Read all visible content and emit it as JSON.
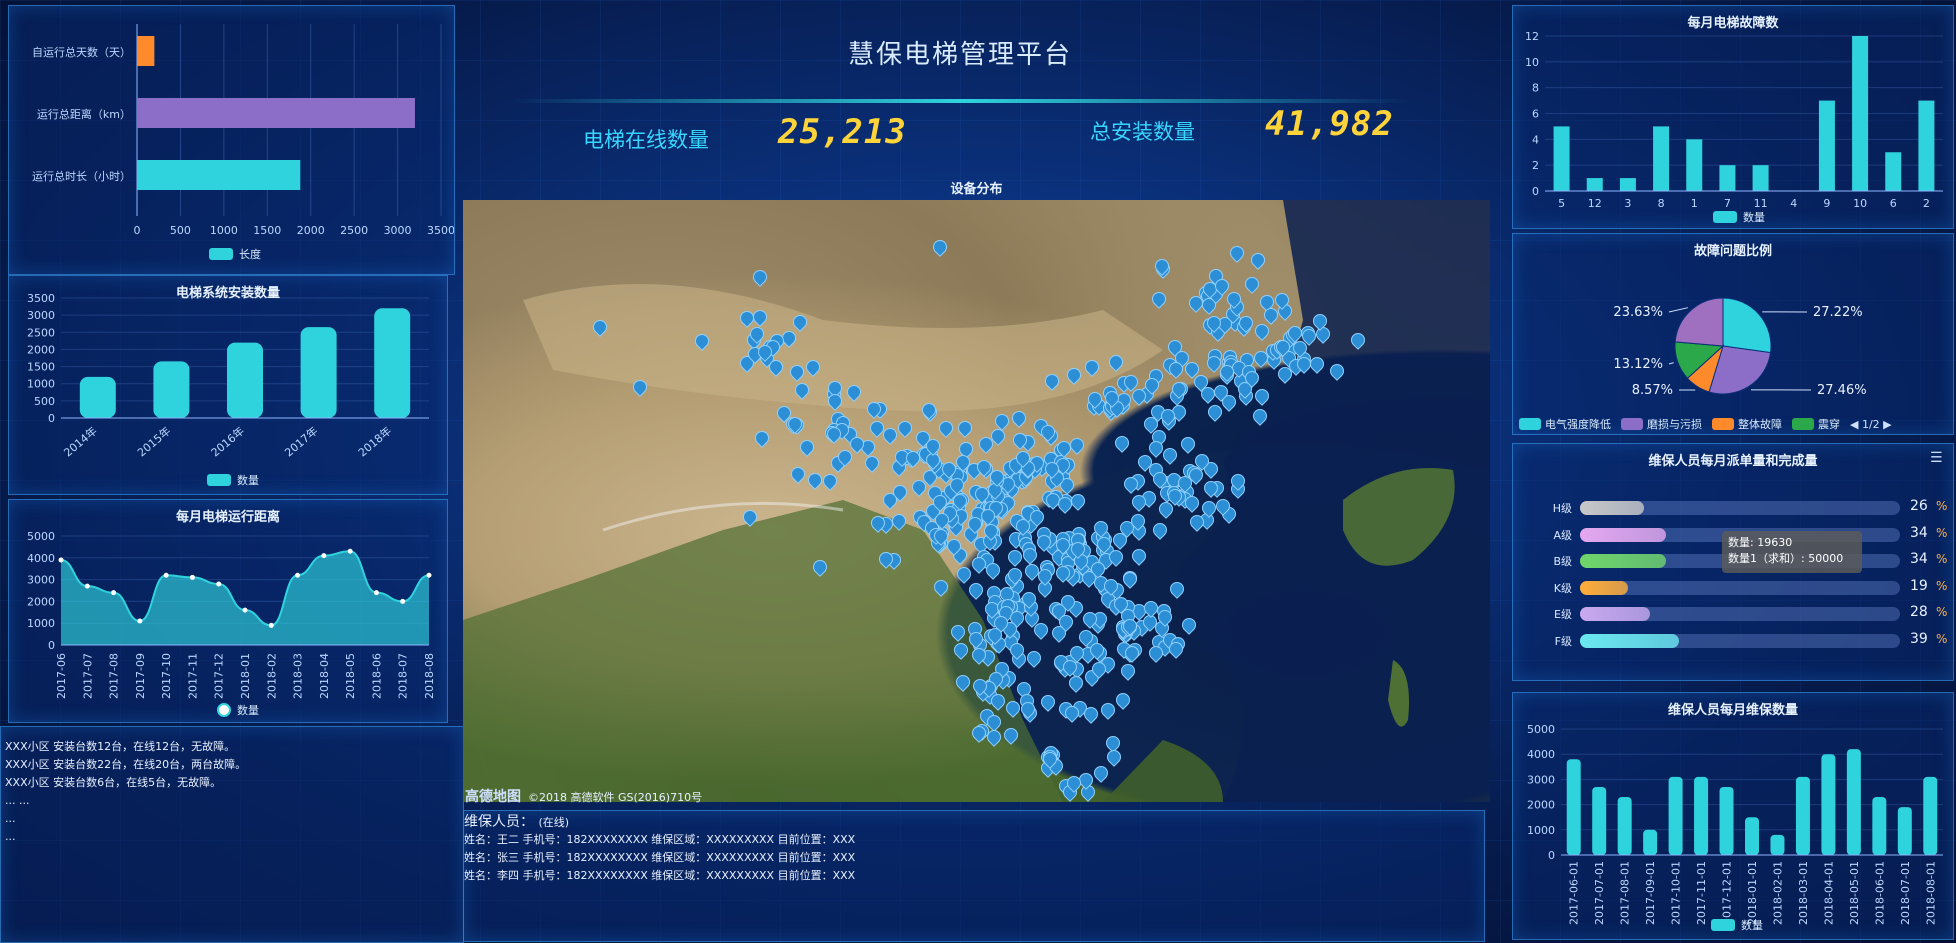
{
  "header": {
    "title": "慧保电梯管理平台",
    "online_label": "电梯在线数量",
    "online_value": "25,213",
    "installed_label": "总安装数量",
    "installed_value": "41,982"
  },
  "top_left": {
    "categories": [
      "自运行总天数（天）",
      "运行总距离（km）",
      "运行总时长（小时）"
    ],
    "values": [
      200,
      3200,
      1880
    ],
    "colors": [
      "#ff8a2b",
      "#8c6ec8",
      "#2fd3dd"
    ],
    "ticks": [
      "0",
      "500",
      "1000",
      "1500",
      "2000",
      "2500",
      "3000",
      "3500"
    ],
    "legend": "长度"
  },
  "install_chart": {
    "title": "电梯系统安装数量",
    "categories": [
      "2014年",
      "2015年",
      "2016年",
      "2017年",
      "2018年"
    ],
    "values": [
      1200,
      1650,
      2200,
      2650,
      3200
    ],
    "yticks": [
      "0",
      "500",
      "1000",
      "1500",
      "2000",
      "2500",
      "3000",
      "3500"
    ],
    "legend": "数量"
  },
  "distance_chart": {
    "title": "每月电梯运行距离",
    "categories": [
      "2017-06",
      "2017-07",
      "2017-08",
      "2017-09",
      "2017-10",
      "2017-11",
      "2017-12",
      "2018-01",
      "2018-02",
      "2018-03",
      "2018-04",
      "2018-05",
      "2018-06",
      "2018-07",
      "2018-08"
    ],
    "values": [
      3900,
      2700,
      2400,
      1100,
      3200,
      3100,
      2800,
      1600,
      900,
      3200,
      4100,
      4300,
      2400,
      2000,
      3200
    ],
    "yticks": [
      "0",
      "1000",
      "2000",
      "3000",
      "4000",
      "5000"
    ],
    "legend": "数量"
  },
  "notices": [
    "XXX小区 安装台数12台，在线12台，无故障。",
    "XXX小区 安装台数22台，在线20台，两台故障。",
    "XXX小区 安装台数6台，在线5台，无故障。",
    "... ...",
    "...",
    "..."
  ],
  "map": {
    "title": "设备分布",
    "credit_logo": "高德地图",
    "credit_text": "©2018 高德软件 GS(2016)710号"
  },
  "staff": {
    "heading": "维保人员：",
    "status": "(在线)",
    "rows": [
      "姓名：王二    手机号：182XXXXXXXX  维保区域：XXXXXXXXX  目前位置：XXX",
      "姓名：张三    手机号：182XXXXXXXX  维保区域：XXXXXXXXX  目前位置：XXX",
      "姓名：李四    手机号：182XXXXXXXX  维保区域：XXXXXXXXX  目前位置：XXX"
    ]
  },
  "fault_monthly": {
    "title": "每月电梯故障数",
    "categories": [
      "5",
      "12",
      "3",
      "8",
      "1",
      "7",
      "11",
      "4",
      "9",
      "10",
      "6",
      "2"
    ],
    "values": [
      5,
      1,
      1,
      5,
      4,
      2,
      2,
      0,
      7,
      12,
      3,
      7
    ],
    "yticks": [
      "0",
      "2",
      "4",
      "6",
      "8",
      "10",
      "12"
    ],
    "legend": "数量"
  },
  "fault_ratio": {
    "title": "故障问题比例",
    "slices": [
      {
        "name": "电气强度降低",
        "value": 27.22,
        "color": "#2fd3dd"
      },
      {
        "name": "磨损与污损",
        "value": 27.46,
        "color": "#8c6ec8"
      },
      {
        "name": "整体故障",
        "value": 8.57,
        "color": "#ff8a2b"
      },
      {
        "name": "震穿",
        "value": 13.12,
        "color": "#2aa84a"
      },
      {
        "name": "",
        "value": 23.63,
        "color": "#a070c0"
      }
    ],
    "labels": [
      "27.22%",
      "27.46%",
      "8.57%",
      "13.12%",
      "23.63%"
    ],
    "pager": "1/2"
  },
  "dispatch": {
    "title": "维保人员每月派单量和完成量",
    "rows": [
      {
        "label": "H级",
        "value": "26",
        "fill": 0.2,
        "color": "#c8c8c8"
      },
      {
        "label": "A级",
        "value": "34",
        "fill": 0.27,
        "color": "#e4a8f0"
      },
      {
        "label": "B级",
        "value": "34",
        "fill": 0.27,
        "color": "#6fd66a"
      },
      {
        "label": "K级",
        "value": "19",
        "fill": 0.15,
        "color": "#ffae3a"
      },
      {
        "label": "E级",
        "value": "28",
        "fill": 0.22,
        "color": "#c9a9ef"
      },
      {
        "label": "F级",
        "value": "39",
        "fill": 0.31,
        "color": "#6be8f0"
      }
    ],
    "pct_sign": "%",
    "tooltip_line1": "数量: 19630",
    "tooltip_line2": "数量1（求和）: 50000"
  },
  "maintenance": {
    "title": "维保人员每月维保数量",
    "categories": [
      "2017-06-01",
      "2017-07-01",
      "2017-08-01",
      "2017-09-01",
      "2017-10-01",
      "2017-11-01",
      "2017-12-01",
      "2018-01-01",
      "2018-02-01",
      "2018-03-01",
      "2018-04-01",
      "2018-05-01",
      "2018-06-01",
      "2018-07-01",
      "2018-08-01"
    ],
    "values": [
      3800,
      2700,
      2300,
      1000,
      3100,
      3100,
      2700,
      1500,
      800,
      3100,
      4000,
      4200,
      2300,
      1900,
      3100
    ],
    "yticks": [
      "0",
      "1000",
      "2000",
      "3000",
      "4000",
      "5000"
    ],
    "legend": "数量"
  },
  "colors": {
    "accent": "#2fd3dd",
    "value_yellow": "#ffd43b",
    "pin": "#2c8fd6"
  }
}
